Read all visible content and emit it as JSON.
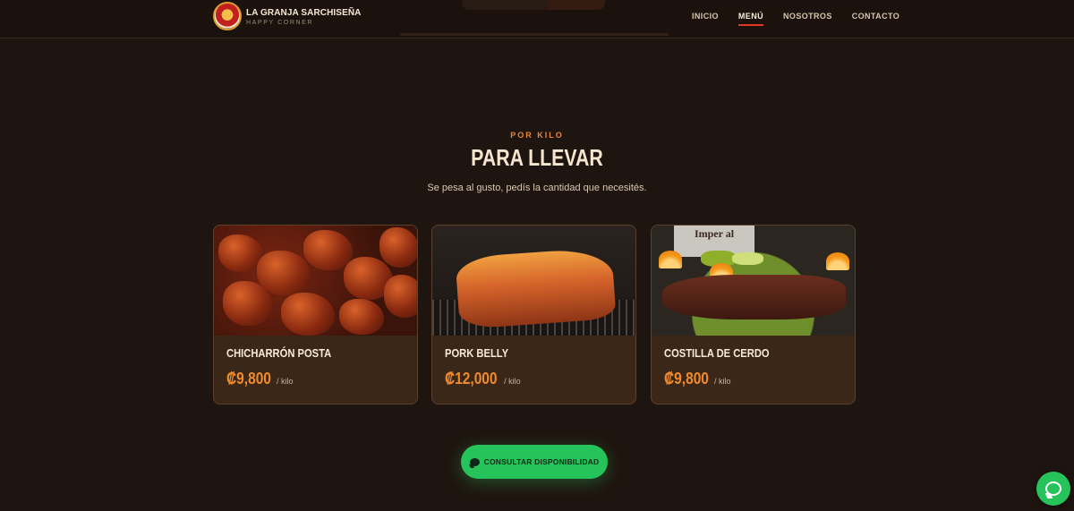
{
  "header": {
    "brand_name": "LA GRANJA SARCHISEÑA",
    "brand_tagline": "HAPPY CORNER",
    "nav": [
      {
        "label": "INICIO",
        "active": false
      },
      {
        "label": "MENÚ",
        "active": true
      },
      {
        "label": "NOSOTROS",
        "active": false
      },
      {
        "label": "CONTACTO",
        "active": false
      }
    ]
  },
  "section": {
    "eyebrow": "POR KILO",
    "title": "PARA LLEVAR",
    "subtitle": "Se pesa al gusto, pedís la cantidad que necesités."
  },
  "products": [
    {
      "name": "CHICHARRÓN POSTA",
      "price": "₡9,800",
      "unit": "/ kilo",
      "image_icon": "chicharron-photo"
    },
    {
      "name": "PORK BELLY",
      "price": "₡12,000",
      "unit": "/ kilo",
      "image_icon": "pork-belly-photo"
    },
    {
      "name": "COSTILLA DE CERDO",
      "price": "₡9,800",
      "unit": "/ kilo",
      "image_icon": "costilla-photo",
      "image_text": "Imper al"
    }
  ],
  "cta": {
    "label": "CONSULTAR DISPONIBILIDAD",
    "icon": "chat-bubble-icon"
  },
  "fab": {
    "icon": "whatsapp-icon"
  },
  "colors": {
    "background": "#1f1510",
    "accent_orange": "#f08a2c",
    "accent_red": "#e0391f",
    "whatsapp_green": "#25c35a",
    "card_bg": "#3b2718"
  }
}
